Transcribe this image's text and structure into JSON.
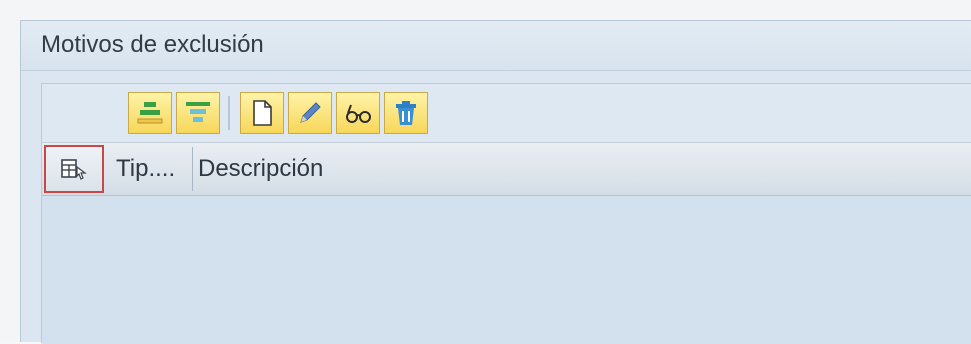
{
  "panel": {
    "title": "Motivos de exclusión"
  },
  "toolbar": {
    "buttons": [
      {
        "name": "align-top-icon"
      },
      {
        "name": "align-bottom-icon"
      },
      {
        "name": "new-document-icon"
      },
      {
        "name": "pencil-icon"
      },
      {
        "name": "glasses-icon"
      },
      {
        "name": "trash-icon"
      }
    ]
  },
  "table": {
    "columns": [
      "Tip....",
      "Descripción"
    ],
    "layout_button_icon": "layout-settings-icon"
  },
  "colors": {
    "panel_bg": "#dbe6f0",
    "button_bg": "#f7d75a",
    "layout_button_border": "#c84848"
  }
}
